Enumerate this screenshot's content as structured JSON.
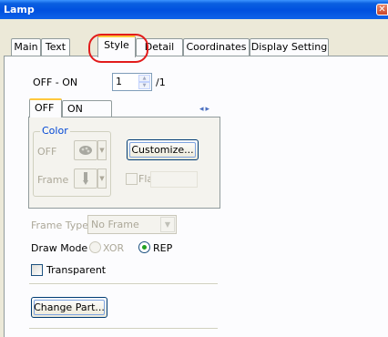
{
  "window": {
    "title": "Lamp",
    "close_glyph": "✕"
  },
  "tabs": [
    {
      "label": "Main"
    },
    {
      "label": "Text"
    },
    {
      "label": "Style"
    },
    {
      "label": "Detail"
    },
    {
      "label": "Coordinates"
    },
    {
      "label": "Display Setting"
    }
  ],
  "active_tab": "Style",
  "off_on": {
    "label": "OFF - ON",
    "value": "1",
    "suffix": "/1"
  },
  "state_tabs": [
    {
      "label": "OFF"
    },
    {
      "label": "ON"
    }
  ],
  "nav_arrows": "◂▸",
  "color_group": {
    "legend": "Color",
    "off_label": "OFF",
    "frame_label": "Frame",
    "customize_label": "Customize...",
    "flash_label": "Flash"
  },
  "frame_type": {
    "label": "Frame Type",
    "value": "No Frame"
  },
  "draw_mode": {
    "label": "Draw Mode",
    "options": [
      "XOR",
      "REP"
    ],
    "selected": "REP"
  },
  "transparent": {
    "label": "Transparent",
    "checked": false
  },
  "change_part_label": "Change Part...",
  "colors": {
    "title_bar": "#0050df",
    "highlight_ring": "#e21b1b",
    "tab_accent": "#ffc83c"
  }
}
